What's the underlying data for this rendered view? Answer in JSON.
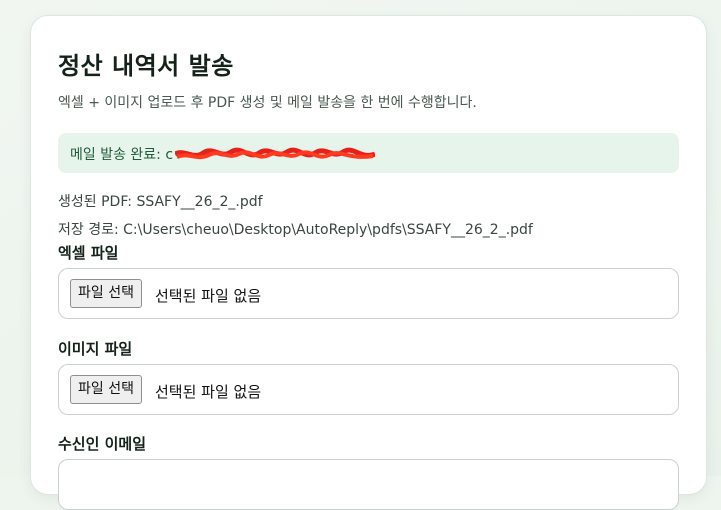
{
  "header": {
    "title": "정산 내역서 발송",
    "subtitle": "엑셀 + 이미지 업로드 후 PDF 생성 및 메일 발송을 한 번에 수행합니다."
  },
  "alert": {
    "label": "메일 발송 완료: ",
    "recipient_visible": "c",
    "status_color": "#e6f4ec"
  },
  "result": {
    "pdf_line": "생성된 PDF: SSAFY__26_2_.pdf",
    "path_line": "저장 경로: C:\\Users\\cheuo\\Desktop\\AutoReply\\pdfs\\SSAFY__26_2_.pdf"
  },
  "form": {
    "excel": {
      "label": "엑셀 파일",
      "button": "파일 선택",
      "status": "선택된 파일 없음"
    },
    "image": {
      "label": "이미지 파일",
      "button": "파일 선택",
      "status": "선택된 파일 없음"
    },
    "email": {
      "label": "수신인 이메일",
      "placeholder": ""
    }
  }
}
